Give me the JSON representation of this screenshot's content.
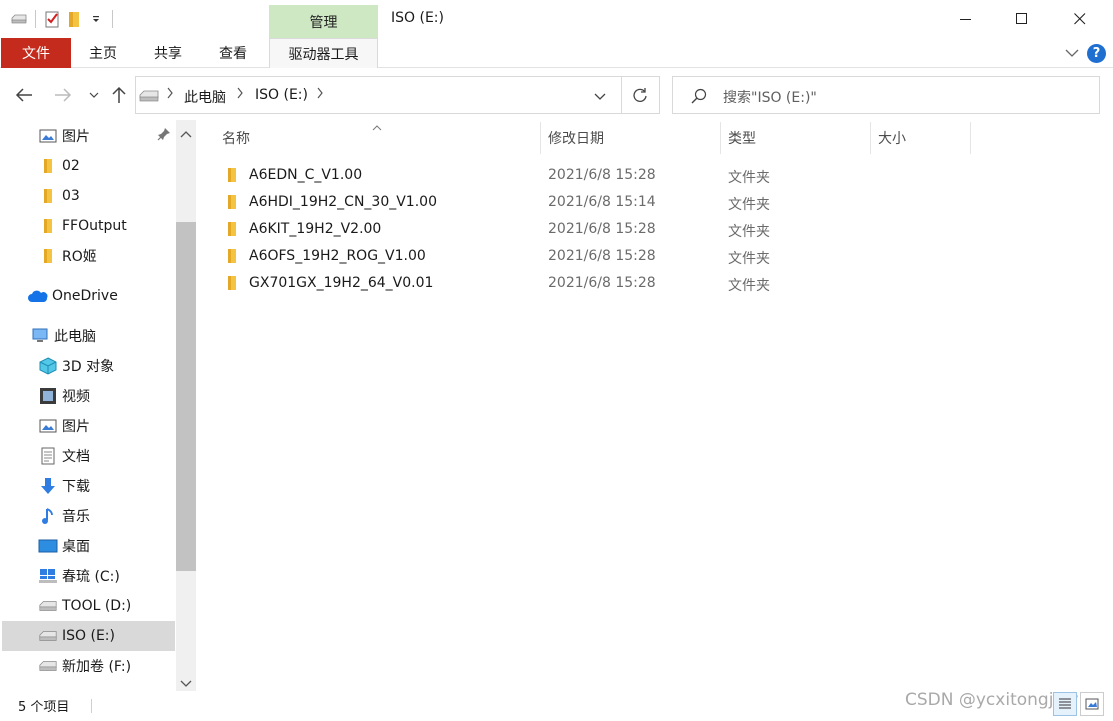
{
  "window": {
    "title": "ISO (E:)",
    "contextual_tab_group": "管理",
    "controls": {
      "minimize": "—",
      "maximize": "☐",
      "close": "✕"
    }
  },
  "ribbon": {
    "tabs": [
      {
        "label": "文件",
        "icon": null
      },
      {
        "label": "主页"
      },
      {
        "label": "共享"
      },
      {
        "label": "查看"
      },
      {
        "label": "驱动器工具"
      }
    ],
    "help_label": "?"
  },
  "address": {
    "path": [
      "此电脑",
      "ISO (E:)"
    ],
    "drive_icon": "drive-icon"
  },
  "search": {
    "placeholder": "搜索\"ISO (E:)\""
  },
  "sidebar": {
    "items": [
      {
        "label": "图片",
        "icon": "pictures-icon",
        "pinned": true
      },
      {
        "label": "02",
        "icon": "folder-icon"
      },
      {
        "label": "03",
        "icon": "folder-icon"
      },
      {
        "label": "FFOutput",
        "icon": "folder-icon"
      },
      {
        "label": "RO姬",
        "icon": "folder-icon"
      },
      {
        "label": "OneDrive",
        "icon": "onedrive-icon"
      },
      {
        "label": "此电脑",
        "icon": "this-pc-icon"
      },
      {
        "label": "3D 对象",
        "icon": "3d-objects-icon"
      },
      {
        "label": "视频",
        "icon": "videos-icon"
      },
      {
        "label": "图片",
        "icon": "pictures-icon"
      },
      {
        "label": "文档",
        "icon": "documents-icon"
      },
      {
        "label": "下载",
        "icon": "downloads-icon"
      },
      {
        "label": "音乐",
        "icon": "music-icon"
      },
      {
        "label": "桌面",
        "icon": "desktop-icon"
      },
      {
        "label": "春琉 (C:)",
        "icon": "windows-drive-icon"
      },
      {
        "label": "TOOL (D:)",
        "icon": "drive-icon"
      },
      {
        "label": "ISO (E:)",
        "icon": "drive-icon",
        "selected": true
      },
      {
        "label": "新加卷 (F:)",
        "icon": "drive-icon"
      }
    ]
  },
  "columns": {
    "name": "名称",
    "modified": "修改日期",
    "type": "类型",
    "size": "大小"
  },
  "files": [
    {
      "name": "A6EDN_C_V1.00",
      "modified": "2021/6/8 15:28",
      "type": "文件夹"
    },
    {
      "name": "A6HDI_19H2_CN_30_V1.00",
      "modified": "2021/6/8 15:14",
      "type": "文件夹"
    },
    {
      "name": "A6KIT_19H2_V2.00",
      "modified": "2021/6/8 15:28",
      "type": "文件夹"
    },
    {
      "name": "A6OFS_19H2_ROG_V1.00",
      "modified": "2021/6/8 15:28",
      "type": "文件夹"
    },
    {
      "name": "GX701GX_19H2_64_V0.01",
      "modified": "2021/6/8 15:28",
      "type": "文件夹"
    }
  ],
  "status": {
    "item_count": "5 个项目"
  },
  "watermark": "CSDN @ycxitongjiayu",
  "colors": {
    "file_tab": "#c42b1c",
    "manage_tab": "#cfe8c4",
    "selection": "#d9d9d9",
    "folder": "#f5c342",
    "accent": "#1f6fd1"
  }
}
